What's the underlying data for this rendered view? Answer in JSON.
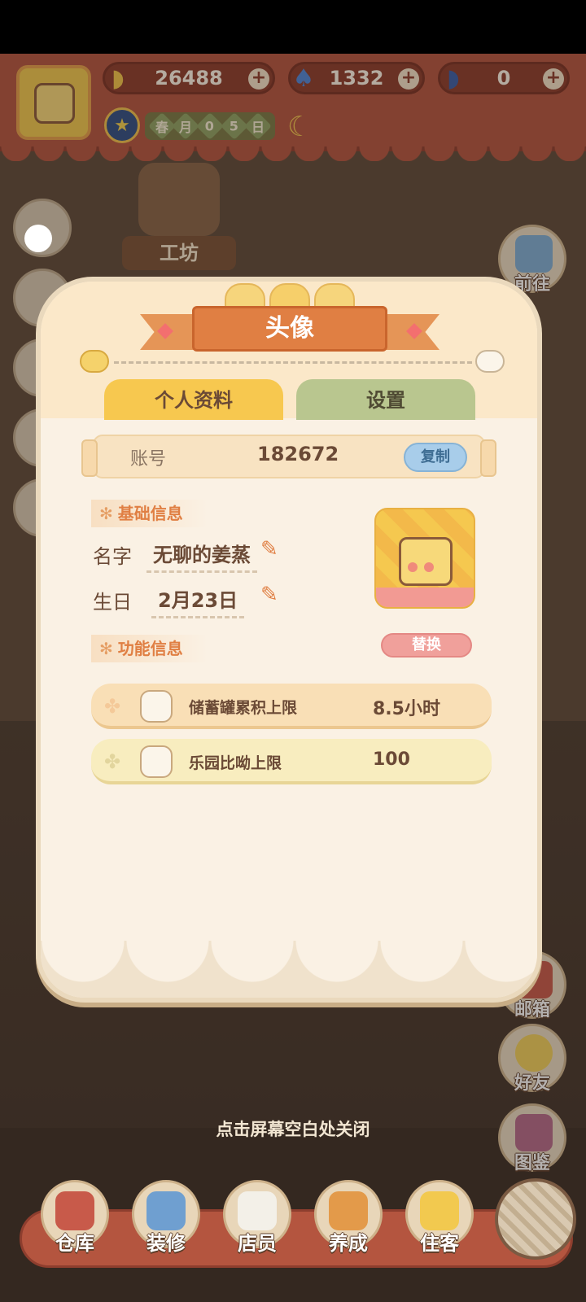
{
  "top_bar": {
    "bananas": "26488",
    "flames": "1332",
    "blue_bananas": "0",
    "date": [
      "春",
      "月",
      "0",
      "5",
      "日"
    ]
  },
  "workshop": {
    "label": "工坊"
  },
  "right_buttons": [
    "前往",
    "邮箱",
    "好友",
    "图鉴"
  ],
  "modal": {
    "title": "头像",
    "tabs": {
      "profile": "个人资料",
      "settings": "设置"
    },
    "account": {
      "label": "账号",
      "value": "182672",
      "copy": "复制"
    },
    "basic_section": "基础信息",
    "name_label": "名字",
    "name_value": "无聊的姜蒸",
    "birthday_label": "生日",
    "birthday_value": "2月23日",
    "function_section": "功能信息",
    "replace": "替换",
    "features": [
      {
        "name": "储蓄罐累积上限",
        "value": "8.5小时"
      },
      {
        "name": "乐园比呦上限",
        "value": "100"
      }
    ]
  },
  "close_hint": "点击屏幕空白处关闭",
  "bottom_nav": [
    "仓库",
    "装修",
    "店员",
    "养成",
    "住客"
  ],
  "icons": {
    "banana": "banana-icon",
    "flame": "flame-icon",
    "moon": "moon-icon",
    "pencil": "pencil-icon",
    "clover": "clover-icon"
  },
  "colors": {
    "accent_orange": "#e07f43",
    "top_bar_red": "#b4553f",
    "tab_yellow": "#f7c84f",
    "tab_green": "#b9c68f",
    "copy_blue": "#a8cdea",
    "replace_pink": "#f0a09b"
  }
}
